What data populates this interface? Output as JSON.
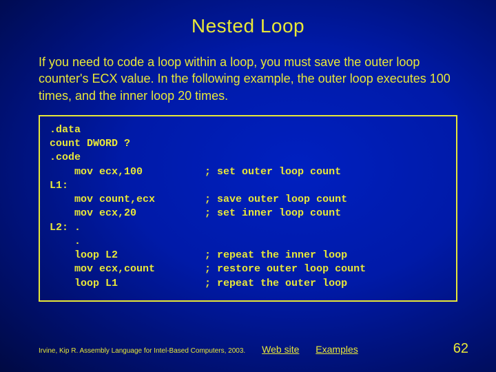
{
  "title": "Nested Loop",
  "body": "If you need to code a loop within a loop, you must save the outer loop counter's ECX value. In the following example, the outer loop executes 100 times, and the inner loop 20 times.",
  "code": ".data\ncount DWORD ?\n.code\n    mov ecx,100          ; set outer loop count\nL1:\n    mov count,ecx        ; save outer loop count\n    mov ecx,20           ; set inner loop count\nL2: .\n    .\n    loop L2              ; repeat the inner loop\n    mov ecx,count        ; restore outer loop count\n    loop L1              ; repeat the outer loop",
  "footer": {
    "citation": "Irvine, Kip R. Assembly Language for Intel-Based Computers, 2003.",
    "link1": "Web site",
    "link2": "Examples",
    "pagenum": "62"
  }
}
